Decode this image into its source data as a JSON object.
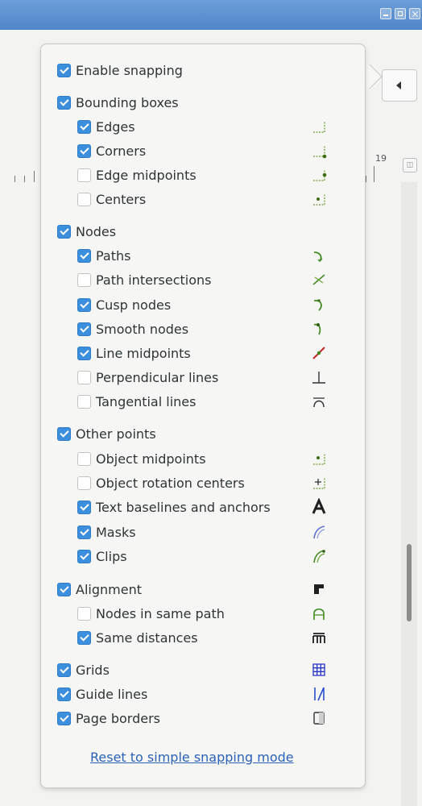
{
  "window": {
    "controls": [
      "minimize",
      "maximize",
      "close"
    ]
  },
  "ruler": {
    "number": "19"
  },
  "snap": {
    "enable": {
      "label": "Enable snapping",
      "checked": true
    },
    "bounding_boxes": {
      "label": "Bounding boxes",
      "checked": true
    },
    "edges": {
      "label": "Edges",
      "checked": true,
      "icon": "snap-bbox-edges-icon"
    },
    "corners": {
      "label": "Corners",
      "checked": true,
      "icon": "snap-bbox-corners-icon"
    },
    "edge_midpoints": {
      "label": "Edge midpoints",
      "checked": false,
      "icon": "snap-bbox-edge-midpoints-icon"
    },
    "centers": {
      "label": "Centers",
      "checked": false,
      "icon": "snap-bbox-centers-icon"
    },
    "nodes": {
      "label": "Nodes",
      "checked": true
    },
    "paths": {
      "label": "Paths",
      "checked": true,
      "icon": "snap-paths-icon"
    },
    "path_intersections": {
      "label": "Path intersections",
      "checked": false,
      "icon": "snap-path-intersections-icon"
    },
    "cusp_nodes": {
      "label": "Cusp nodes",
      "checked": true,
      "icon": "snap-cusp-nodes-icon"
    },
    "smooth_nodes": {
      "label": "Smooth nodes",
      "checked": true,
      "icon": "snap-smooth-nodes-icon"
    },
    "line_midpoints": {
      "label": "Line midpoints",
      "checked": true,
      "icon": "snap-line-midpoints-icon"
    },
    "perpendicular_lines": {
      "label": "Perpendicular lines",
      "checked": false,
      "icon": "snap-perpendicular-icon"
    },
    "tangential_lines": {
      "label": "Tangential lines",
      "checked": false,
      "icon": "snap-tangential-icon"
    },
    "other_points": {
      "label": "Other points",
      "checked": true
    },
    "object_midpoints": {
      "label": "Object midpoints",
      "checked": false,
      "icon": "snap-object-midpoints-icon"
    },
    "rotation_centers": {
      "label": "Object rotation centers",
      "checked": false,
      "icon": "snap-rotation-centers-icon"
    },
    "text_baselines": {
      "label": "Text baselines and anchors",
      "checked": true,
      "icon": "snap-text-baseline-icon"
    },
    "masks": {
      "label": "Masks",
      "checked": true,
      "icon": "snap-masks-icon"
    },
    "clips": {
      "label": "Clips",
      "checked": true,
      "icon": "snap-clips-icon"
    },
    "alignment": {
      "label": "Alignment",
      "checked": true,
      "icon": "snap-alignment-icon"
    },
    "nodes_same_path": {
      "label": "Nodes in same path",
      "checked": false,
      "icon": "snap-nodes-same-path-icon"
    },
    "same_distances": {
      "label": "Same distances",
      "checked": true,
      "icon": "snap-same-distances-icon"
    },
    "grids": {
      "label": "Grids",
      "checked": true,
      "icon": "snap-grids-icon"
    },
    "guide_lines": {
      "label": "Guide lines",
      "checked": true,
      "icon": "snap-guide-lines-icon"
    },
    "page_borders": {
      "label": "Page borders",
      "checked": true,
      "icon": "snap-page-borders-icon"
    }
  },
  "reset_link": "Reset to simple snapping mode",
  "colors": {
    "checkbox_on": "#3c8fdc",
    "link": "#2a62b7",
    "titlebar": "#5a8fd0"
  }
}
